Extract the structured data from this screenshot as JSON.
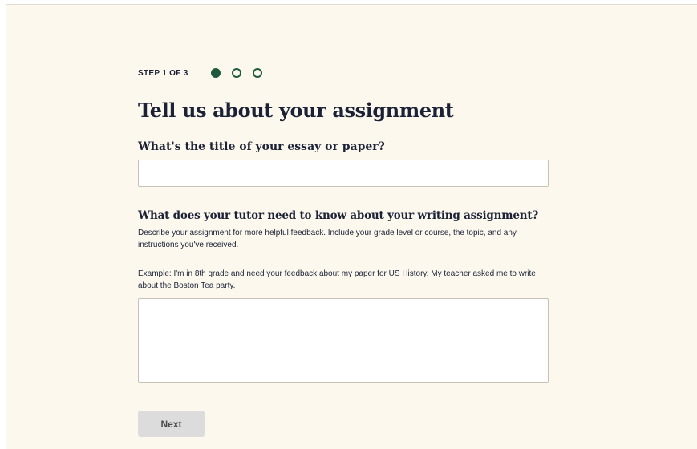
{
  "step": {
    "label": "STEP 1 OF 3",
    "current": 1,
    "total": 3
  },
  "colors": {
    "background": "#fdf8ee",
    "accent": "#1d5a3e",
    "text": "#1b2236",
    "button_disabled_bg": "#dcdcdc"
  },
  "page": {
    "title": "Tell us about your assignment"
  },
  "essay_title": {
    "question": "What's the title of your essay or paper?",
    "value": ""
  },
  "assignment_details": {
    "question": "What does your tutor need to know about your writing assignment?",
    "description": "Describe your assignment for more helpful feedback. Include your grade level or course, the topic, and any instructions you've received.",
    "example": "Example: I'm in 8th grade and need your feedback about my paper for US History. My teacher asked me to write about the Boston Tea party.",
    "value": ""
  },
  "actions": {
    "next_label": "Next"
  }
}
